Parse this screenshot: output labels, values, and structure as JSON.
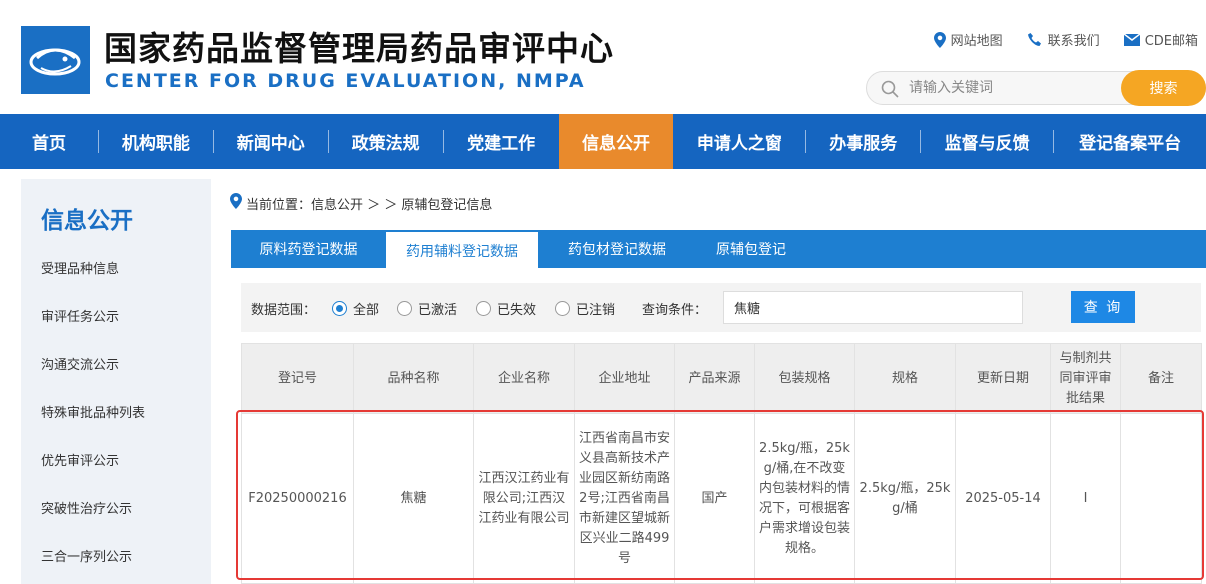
{
  "header": {
    "title_cn": "国家药品监督管理局药品审评中心",
    "title_en": "CENTER FOR DRUG EVALUATION, NMPA",
    "links": [
      {
        "label": "网站地图",
        "icon": "location-pin-icon"
      },
      {
        "label": "联系我们",
        "icon": "phone-icon"
      },
      {
        "label": "CDE邮箱",
        "icon": "mail-icon"
      }
    ],
    "search": {
      "placeholder": "请输入关键词",
      "button": "搜索"
    }
  },
  "nav": {
    "items": [
      "首页",
      "机构职能",
      "新闻中心",
      "政策法规",
      "党建工作",
      "信息公开",
      "申请人之窗",
      "办事服务",
      "监督与反馈",
      "登记备案平台"
    ],
    "active": "信息公开"
  },
  "sidebar": {
    "title": "信息公开",
    "items": [
      "受理品种信息",
      "审评任务公示",
      "沟通交流公示",
      "特殊审批品种列表",
      "优先审评公示",
      "突破性治疗公示",
      "三合一序列公示"
    ]
  },
  "breadcrumb": {
    "prefix": "当前位置：信息公开 ＞ ＞ 原辅包登记信息"
  },
  "tabs": {
    "items": [
      "原料药登记数据",
      "药用辅料登记数据",
      "药包材登记数据",
      "原辅包登记"
    ],
    "active": "药用辅料登记数据"
  },
  "filter": {
    "scope_label": "数据范围：",
    "options": [
      "全部",
      "已激活",
      "已失效",
      "已注销"
    ],
    "selected": "全部",
    "condition_label": "查询条件：",
    "query_value": "焦糖",
    "query_button": "查 询"
  },
  "table": {
    "headers": [
      "登记号",
      "品种名称",
      "企业名称",
      "企业地址",
      "产品来源",
      "包装规格",
      "规格",
      "更新日期",
      "与制剂共同审评审批结果",
      "备注"
    ],
    "rows": [
      [
        "F20250000216",
        "焦糖",
        "江西汉江药业有限公司;江西汉江药业有限公司",
        "江西省南昌市安义县高新技术产业园区新纺南路2号;江西省南昌市新建区望城新区兴业二路499号",
        "国产",
        "2.5kg/瓶，25kg/桶,在不改变内包装材料的情况下，可根据客户需求增设包装规格。",
        "2.5kg/瓶，25kg/桶",
        "2025-05-14",
        "I",
        ""
      ]
    ]
  },
  "colors": {
    "brand_blue": "#1565c0",
    "tab_blue": "#1e7fd1",
    "active_orange": "#e98a2c",
    "search_orange": "#f5a623",
    "highlight_red": "#e53935"
  }
}
